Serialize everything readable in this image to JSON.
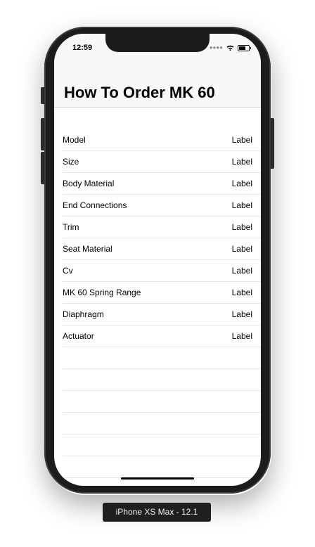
{
  "status_bar": {
    "time": "12:59",
    "signal_icon": "signal-dots-icon",
    "wifi_icon": "wifi-icon",
    "battery_icon": "battery-icon"
  },
  "navigation": {
    "title": "How To Order MK 60"
  },
  "table": {
    "rows": [
      {
        "label": "Model",
        "value": "Label"
      },
      {
        "label": "Size",
        "value": "Label"
      },
      {
        "label": "Body Material",
        "value": "Label"
      },
      {
        "label": "End Connections",
        "value": "Label"
      },
      {
        "label": "Trim",
        "value": "Label"
      },
      {
        "label": "Seat Material",
        "value": "Label"
      },
      {
        "label": "Cv",
        "value": "Label"
      },
      {
        "label": "MK 60 Spring Range",
        "value": "Label"
      },
      {
        "label": "Diaphragm",
        "value": "Label"
      },
      {
        "label": "Actuator",
        "value": "Label"
      }
    ]
  },
  "simulator": {
    "device_label": "iPhone XS Max - 12.1"
  },
  "colors": {
    "frame": "#1c1c1e",
    "nav_background": "#f8f8f8",
    "separator": "#e6e6e6"
  }
}
